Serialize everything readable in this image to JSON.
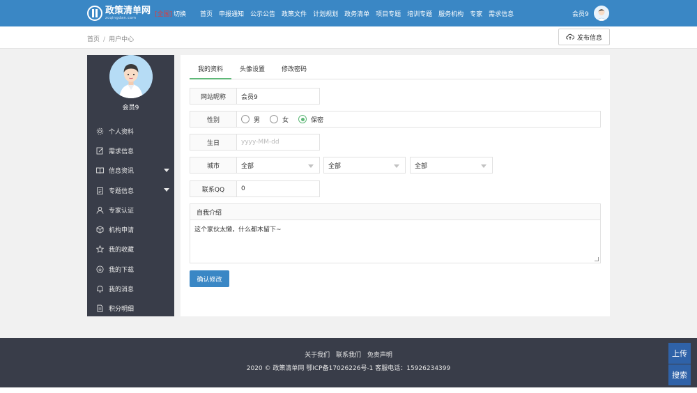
{
  "header": {
    "logo_name": "政策清单网",
    "logo_sub": "zcqingdan.com",
    "region": "[全国]",
    "switch_label": "切换",
    "nav": [
      "首页",
      "申报通知",
      "公示公告",
      "政策文件",
      "计划规划",
      "政务清单",
      "项目专题",
      "培训专题",
      "服务机构",
      "专家",
      "需求信息"
    ],
    "user_name": "会员9"
  },
  "breadcrumb": {
    "home": "首页",
    "separator": "/",
    "current": "用户中心"
  },
  "publish_button": "发布信息",
  "sidebar": {
    "profile_name": "会员9",
    "items": [
      {
        "label": "个人资料",
        "icon": "gear-icon",
        "has_caret": false
      },
      {
        "label": "需求信息",
        "icon": "edit-icon",
        "has_caret": false
      },
      {
        "label": "信息资讯",
        "icon": "book-icon",
        "has_caret": true
      },
      {
        "label": "专题信息",
        "icon": "clipboard-icon",
        "has_caret": true
      },
      {
        "label": "专家认证",
        "icon": "user-icon",
        "has_caret": false
      },
      {
        "label": "机构申请",
        "icon": "cube-icon",
        "has_caret": false
      },
      {
        "label": "我的收藏",
        "icon": "star-icon",
        "has_caret": false
      },
      {
        "label": "我的下载",
        "icon": "download-icon",
        "has_caret": false
      },
      {
        "label": "我的消息",
        "icon": "bell-icon",
        "has_caret": false
      },
      {
        "label": "积分明细",
        "icon": "document-icon",
        "has_caret": false
      }
    ]
  },
  "tabs": [
    "我的资料",
    "头像设置",
    "修改密码"
  ],
  "form": {
    "nickname_label": "网站昵称",
    "nickname_value": "会员9",
    "gender_label": "性别",
    "gender_options": [
      "男",
      "女",
      "保密"
    ],
    "gender_selected": "保密",
    "birthday_label": "生日",
    "birthday_placeholder": "yyyy-MM-dd",
    "city_label": "城市",
    "city_selects": [
      "全部",
      "全部",
      "全部"
    ],
    "qq_label": "联系QQ",
    "qq_value": "0",
    "intro_label": "自我介绍",
    "intro_value": "这个家伙太懒，什么都木留下~",
    "submit_label": "确认修改"
  },
  "footer": {
    "links": [
      "关于我们",
      "联系我们",
      "免责声明"
    ],
    "copyright": "2020 ©  政策清单网  鄂ICP备17026226号-1 客服电话：15926234399"
  },
  "side_buttons": {
    "upload": "上传",
    "search": "搜索"
  },
  "colors": {
    "header": "#3a87c5",
    "sidebar": "#393d49",
    "accent_green": "#5fb878",
    "side_button": "#2f62a8"
  }
}
